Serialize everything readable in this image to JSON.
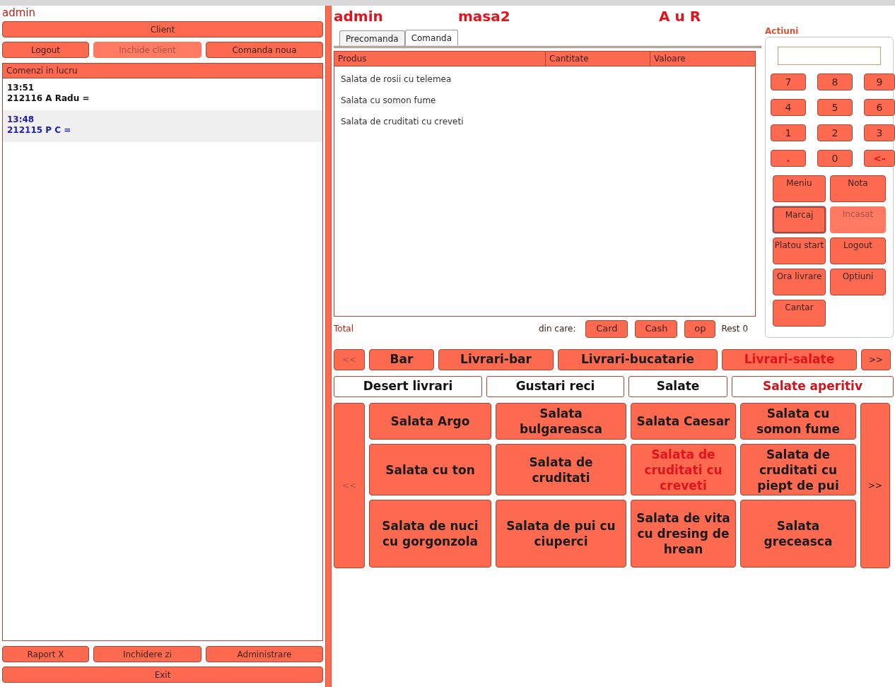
{
  "left": {
    "user": "admin",
    "client_button": "Client",
    "top_buttons": [
      {
        "label": "Logout",
        "disabled": false
      },
      {
        "label": "Inchide client",
        "disabled": true
      },
      {
        "label": "Comanda noua",
        "disabled": false
      }
    ],
    "orders_title": "Comenzi in lucru",
    "orders": [
      {
        "time": "13:51",
        "text": "212116 A Radu =",
        "selected": false
      },
      {
        "time": "13:48",
        "text": "212115 P C =",
        "selected": true
      }
    ],
    "bottom_buttons": [
      {
        "label": "Raport X",
        "disabled": false
      },
      {
        "label": "Inchidere zi",
        "disabled": false
      },
      {
        "label": "Administrare",
        "disabled": false
      }
    ],
    "exit_button": "Exit"
  },
  "header": {
    "user": "admin",
    "table": "masa2",
    "client": "A u R"
  },
  "tabs": [
    {
      "label": "Precomanda",
      "selected": false
    },
    {
      "label": "Comanda",
      "selected": true
    }
  ],
  "table": {
    "columns": [
      "Produs",
      "Cantitate",
      "Valoare"
    ],
    "rows": [
      [
        "Salata de rosii cu telemea"
      ],
      [
        "Salata cu somon fume"
      ],
      [
        "Salata de cruditati cu creveti"
      ]
    ]
  },
  "totals": {
    "label": "Total",
    "din_care": "din care:",
    "pay_buttons": [
      "Card",
      "Cash",
      "op"
    ],
    "rest": "Rest 0"
  },
  "actions": {
    "title": "Actiuni",
    "keys": [
      "7",
      "8",
      "9",
      "4",
      "5",
      "6",
      "1",
      "2",
      "3",
      ".",
      "0",
      "<-"
    ],
    "buttons": [
      {
        "label": "Meniu",
        "disabled": false,
        "focused": false
      },
      {
        "label": "Nota",
        "disabled": false,
        "focused": false
      },
      {
        "label": "Marcaj",
        "disabled": false,
        "focused": true
      },
      {
        "label": "Incasat",
        "disabled": true,
        "focused": false
      },
      {
        "label": "Platou start",
        "disabled": false,
        "focused": false
      },
      {
        "label": "Logout",
        "disabled": false,
        "focused": false
      },
      {
        "label": "Ora livrare",
        "disabled": false,
        "focused": false
      },
      {
        "label": "Optiuni",
        "disabled": false,
        "focused": false
      },
      {
        "label": "Cantar",
        "disabled": false,
        "focused": false
      }
    ]
  },
  "groups": {
    "prev": {
      "label": "<<",
      "disabled": true
    },
    "next": {
      "label": ">>",
      "disabled": false
    },
    "items": [
      {
        "label": "Bar",
        "selected": false
      },
      {
        "label": "Livrari-bar",
        "selected": false
      },
      {
        "label": "Livrari-bucatarie",
        "selected": false
      },
      {
        "label": "Livrari-salate",
        "selected": true
      }
    ]
  },
  "subgroups": [
    {
      "label": "Desert livrari",
      "selected": false
    },
    {
      "label": "Gustari reci",
      "selected": false
    },
    {
      "label": "Salate",
      "selected": false
    },
    {
      "label": "Salate aperitiv",
      "selected": true
    }
  ],
  "products": {
    "prev": {
      "label": "<<",
      "disabled": true
    },
    "next": {
      "label": ">>",
      "disabled": false
    },
    "items": [
      {
        "label": "Salata Argo",
        "selected": false
      },
      {
        "label": "Salata bulgareasca",
        "selected": false
      },
      {
        "label": "Salata Caesar",
        "selected": false
      },
      {
        "label": "Salata cu somon fume",
        "selected": false
      },
      {
        "label": "Salata cu ton",
        "selected": false
      },
      {
        "label": "Salata de cruditati",
        "selected": false
      },
      {
        "label": "Salata de cruditati cu creveti",
        "selected": true
      },
      {
        "label": "Salata de cruditati cu piept de pui",
        "selected": false
      },
      {
        "label": "Salata de nuci cu gorgonzola",
        "selected": false
      },
      {
        "label": "Salata de pui cu ciuperci",
        "selected": false
      },
      {
        "label": "Salata de vita cu dresing de hrean",
        "selected": false
      },
      {
        "label": "Salata greceasca",
        "selected": false
      }
    ]
  }
}
